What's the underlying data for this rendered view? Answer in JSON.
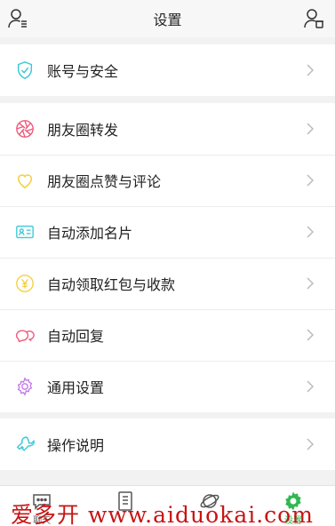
{
  "header": {
    "title": "设置"
  },
  "groups": [
    {
      "items": [
        {
          "label": "账号与安全",
          "icon": "shield-check-icon",
          "color": "#3ec9d6"
        }
      ]
    },
    {
      "items": [
        {
          "label": "朋友圈转发",
          "icon": "aperture-icon",
          "color": "#f0587a"
        },
        {
          "label": "朋友圈点赞与评论",
          "icon": "heart-icon",
          "color": "#f4d03f"
        },
        {
          "label": "自动添加名片",
          "icon": "id-card-icon",
          "color": "#3ec9d6"
        },
        {
          "label": "自动领取红包与收款",
          "icon": "yen-coin-icon",
          "color": "#f4d03f"
        },
        {
          "label": "自动回复",
          "icon": "chat-bubbles-icon",
          "color": "#f0587a"
        },
        {
          "label": "通用设置",
          "icon": "gear-icon",
          "color": "#c27be8"
        }
      ]
    },
    {
      "items": [
        {
          "label": "操作说明",
          "icon": "wrench-icon",
          "color": "#3ec9d6"
        }
      ]
    }
  ],
  "tabs": [
    {
      "label": "聊天",
      "icon": "chat-icon"
    },
    {
      "label": "",
      "icon": "notebook-icon"
    },
    {
      "label": "",
      "icon": "planet-icon"
    },
    {
      "label": "设置",
      "icon": "gear-icon",
      "active": true
    }
  ],
  "watermark": "爱多开 www.aiduokai.com",
  "colors": {
    "accent": "#2fb84f",
    "watermark": "#c81414"
  }
}
